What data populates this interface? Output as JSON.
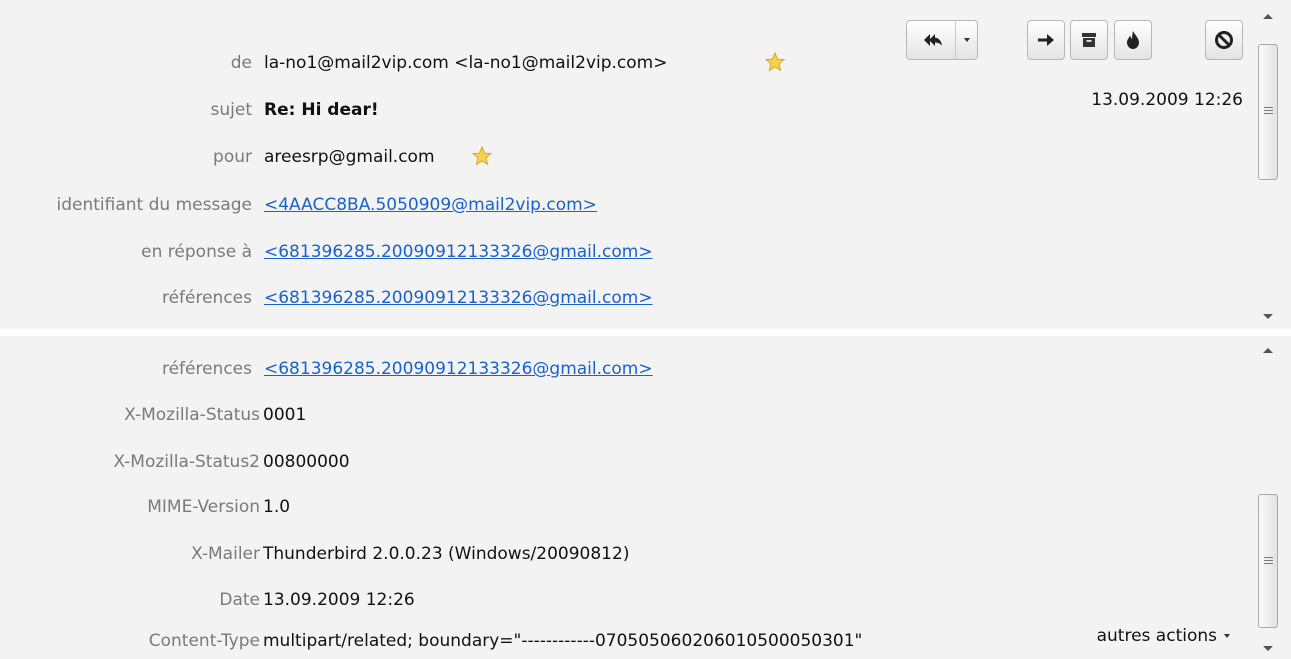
{
  "header": {
    "from": {
      "label": "de",
      "value": "la-no1@mail2vip.com <la-no1@mail2vip.com>"
    },
    "subject": {
      "label": "sujet",
      "value": "Re: Hi dear!"
    },
    "to": {
      "label": "pour",
      "value": "areesrp@gmail.com"
    },
    "message_id": {
      "label": "identifiant du message",
      "value": "<4AACC8BA.5050909@mail2vip.com>"
    },
    "in_reply_to": {
      "label": "en réponse à",
      "value": "<681396285.20090912133326@gmail.com>"
    },
    "references": {
      "label": "références",
      "value": "<681396285.20090912133326@gmail.com>"
    },
    "date": "13.09.2009 12:26"
  },
  "toolbar": {
    "icons": [
      "reply-all-icon",
      "forward-icon",
      "archive-icon",
      "junk-icon",
      "delete-icon"
    ]
  },
  "headers_full": [
    {
      "name": "références",
      "value": "<681396285.20090912133326@gmail.com>",
      "link": true
    },
    {
      "name": "X-Mozilla-Status",
      "value": "0001"
    },
    {
      "name": "X-Mozilla-Status2",
      "value": "00800000"
    },
    {
      "name": "MIME-Version",
      "value": "1.0"
    },
    {
      "name": "X-Mailer",
      "value": "Thunderbird 2.0.0.23 (Windows/20090812)"
    },
    {
      "name": "Date",
      "value": "13.09.2009 12:26"
    },
    {
      "name": "Content-Type",
      "value": "multipart/related; boundary=\"------------070505060206010500050301\""
    }
  ],
  "more_actions_label": "autres actions",
  "colors": {
    "pane_bg": "#f3f3f3",
    "label": "#7a7a7a",
    "link": "#1a62c9"
  }
}
